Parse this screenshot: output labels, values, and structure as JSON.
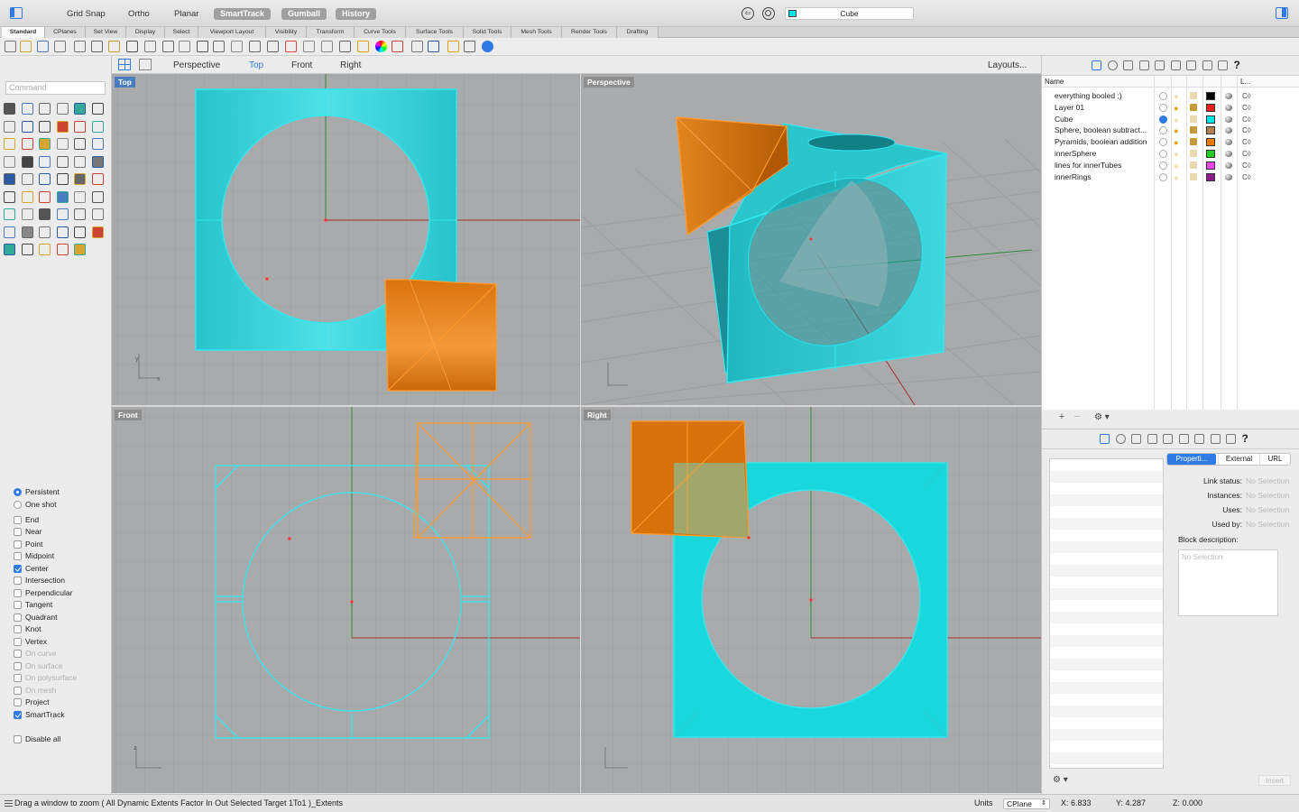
{
  "topbar": {
    "modes": [
      "Grid Snap",
      "Ortho",
      "Planar"
    ],
    "pills": [
      "SmartTrack",
      "Gumball",
      "History"
    ],
    "selection_name": "Cube",
    "selection_color": "#00e5e5"
  },
  "tabs": [
    "Standard",
    "CPlanes",
    "Set View",
    "Display",
    "Select",
    "Viewport Layout",
    "Visibility",
    "Transform",
    "Curve Tools",
    "Surface Tools",
    "Solid Tools",
    "Mesh Tools",
    "Render Tools",
    "Drafting"
  ],
  "viewport_tabs": {
    "items": [
      "Perspective",
      "Top",
      "Front",
      "Right"
    ],
    "active": "Top",
    "layouts_button": "Layouts..."
  },
  "command": {
    "placeholder": "Command"
  },
  "osnaps": [
    {
      "label": "Persistent",
      "type": "radio",
      "checked": true,
      "enabled": true
    },
    {
      "label": "One shot",
      "type": "radio",
      "checked": false,
      "enabled": true
    },
    {
      "label": "End",
      "type": "check",
      "checked": false,
      "enabled": true
    },
    {
      "label": "Near",
      "type": "check",
      "checked": false,
      "enabled": true
    },
    {
      "label": "Point",
      "type": "check",
      "checked": false,
      "enabled": true
    },
    {
      "label": "Midpoint",
      "type": "check",
      "checked": false,
      "enabled": true
    },
    {
      "label": "Center",
      "type": "check",
      "checked": true,
      "enabled": true
    },
    {
      "label": "Intersection",
      "type": "check",
      "checked": false,
      "enabled": true
    },
    {
      "label": "Perpendicular",
      "type": "check",
      "checked": false,
      "enabled": true
    },
    {
      "label": "Tangent",
      "type": "check",
      "checked": false,
      "enabled": true
    },
    {
      "label": "Quadrant",
      "type": "check",
      "checked": false,
      "enabled": true
    },
    {
      "label": "Knot",
      "type": "check",
      "checked": false,
      "enabled": true
    },
    {
      "label": "Vertex",
      "type": "check",
      "checked": false,
      "enabled": true
    },
    {
      "label": "On curve",
      "type": "check",
      "checked": false,
      "enabled": false
    },
    {
      "label": "On surface",
      "type": "check",
      "checked": false,
      "enabled": false
    },
    {
      "label": "On polysurface",
      "type": "check",
      "checked": false,
      "enabled": false
    },
    {
      "label": "On mesh",
      "type": "check",
      "checked": false,
      "enabled": false
    },
    {
      "label": "Project",
      "type": "check",
      "checked": false,
      "enabled": true
    },
    {
      "label": "SmartTrack",
      "type": "check",
      "checked": true,
      "enabled": true
    },
    {
      "label": "Disable all",
      "type": "check",
      "checked": false,
      "enabled": true
    }
  ],
  "viewports": {
    "top": "Top",
    "perspective": "Perspective",
    "front": "Front",
    "right": "Right",
    "axis_x": "x",
    "axis_y": "y",
    "axis_z": "z"
  },
  "layers": {
    "header_name": "Name",
    "header_print": "L...",
    "rows": [
      {
        "name": "everything booled ;)",
        "current": false,
        "on": false,
        "color": "#000000"
      },
      {
        "name": "Layer 01",
        "current": false,
        "on": true,
        "color": "#ee1c1c"
      },
      {
        "name": "Cube",
        "current": true,
        "on": false,
        "color": "#00e5e5"
      },
      {
        "name": "Sphere, boolean subtract...",
        "current": false,
        "on": true,
        "color": "#b08050"
      },
      {
        "name": "Pyramids, boolean addition",
        "current": false,
        "on": true,
        "color": "#f07800"
      },
      {
        "name": "innerSphere",
        "current": false,
        "on": false,
        "color": "#22cc22"
      },
      {
        "name": "lines for innerTubes",
        "current": false,
        "on": false,
        "color": "#ee44ee"
      },
      {
        "name": "innerRings",
        "current": false,
        "on": false,
        "color": "#8a1a8a"
      }
    ],
    "print_glyph": "C◊"
  },
  "properties": {
    "tabs": [
      "Properti...",
      "External",
      "URL"
    ],
    "active_tab": "Properti...",
    "fields": [
      {
        "label": "Link status:",
        "value": "No Selection"
      },
      {
        "label": "Instances:",
        "value": "No Selection"
      },
      {
        "label": "Uses:",
        "value": "No Selection"
      },
      {
        "label": "Used by:",
        "value": "No Selection"
      }
    ],
    "block_desc_label": "Block description:",
    "block_desc_placeholder": "No Selection",
    "insert_button": "Insert"
  },
  "status": {
    "message": "Drag a window to zoom ( All Dynamic Extents Factor In Out Selected Target 1To1 )_Extents",
    "units_label": "Units",
    "cplane": "CPlane",
    "x": "X: 6.833",
    "y": "Y: 4.287",
    "z": "Z: 0.000"
  },
  "colors": {
    "cyan": "#2cd2d8",
    "cyan_edge": "#33e6ee",
    "orange": "#e8841c",
    "orange_edge": "#ff9a2a",
    "vp_bg": "#a9aaac",
    "grid": "#9d9ea1",
    "accent": "#2f7ae5"
  }
}
